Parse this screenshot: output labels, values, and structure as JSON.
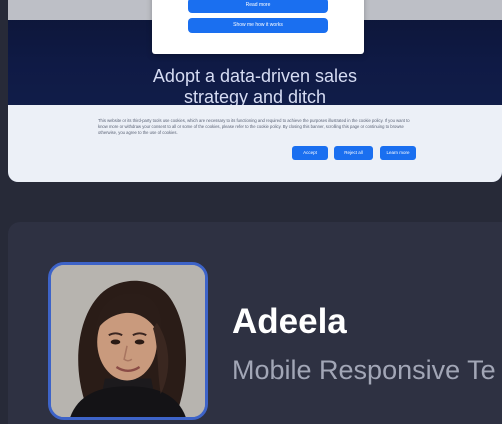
{
  "preview": {
    "popup": {
      "primary_label": "Read more",
      "secondary_label": "Show me how it works"
    },
    "eyebrow": "",
    "headline_line1": "Adopt a data-driven sales",
    "headline_line2": "strategy and ditch",
    "cookie": {
      "text": "This website or its third-party tools use cookies, which are necessary to its functioning and required to achieve the purposes illustrated in the cookie policy. If you want to know more or withdraw your consent to all or some of the cookies, please refer to the cookie policy. By closing this banner, scrolling this page or continuing to browse otherwise, you agree to the use of cookies.",
      "accept_label": "Accept",
      "reject_label": "Reject all",
      "more_label": "Learn more"
    }
  },
  "profile": {
    "name": "Adeela",
    "role": "Mobile Responsive Te",
    "avatar_icon": "portrait-photo",
    "colors": {
      "accent": "#3d63c8",
      "card": "#2e3142",
      "name": "#ffffff",
      "role": "#a2a6b6"
    }
  }
}
